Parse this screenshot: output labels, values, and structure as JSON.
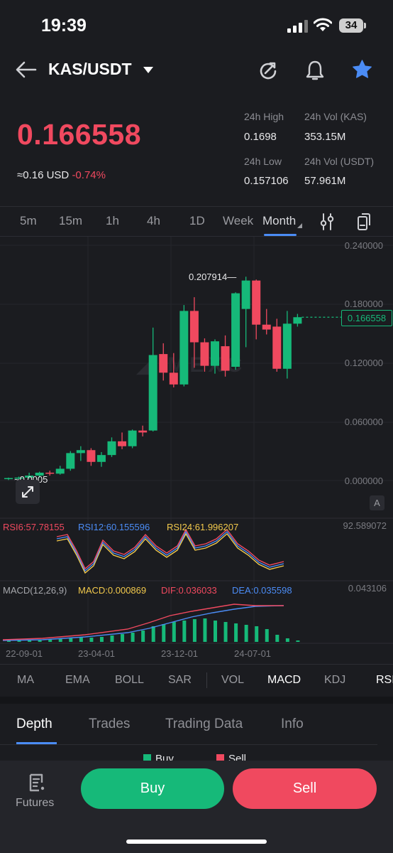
{
  "status_bar": {
    "time": "19:39",
    "battery": "34"
  },
  "header": {
    "pair": "KAS/USDT"
  },
  "ticker": {
    "last_price": "0.166558",
    "usd_approx": "≈0.16 USD",
    "change_pct": "-0.74%",
    "high_label": "24h High",
    "high_value": "0.1698",
    "vol_kas_label": "24h Vol (KAS)",
    "vol_kas_value": "353.15M",
    "low_label": "24h Low",
    "low_value": "0.157106",
    "vol_usdt_label": "24h Vol (USDT)",
    "vol_usdt_value": "57.961M"
  },
  "timeframes": [
    "5m",
    "15m",
    "1h",
    "4h",
    "1D",
    "Week",
    "Month"
  ],
  "active_timeframe": "Month",
  "price_axis": [
    "0.240000",
    "0.180000",
    "0.120000",
    "0.060000",
    "0.000000"
  ],
  "last_price_tag": "0.166558",
  "high_marker": "0.207914",
  "low_marker": "0.0005",
  "auto_button": "A",
  "rsi": {
    "rsi6": "RSI6:57.78155",
    "rsi12": "RSI12:60.155596",
    "rsi24": "RSI24:61.996207",
    "axis_max": "92.589072"
  },
  "macd": {
    "label": "MACD(12,26,9)",
    "macd": "MACD:0.000869",
    "dif": "DIF:0.036033",
    "dea": "DEA:0.035598",
    "axis_max": "0.043106"
  },
  "time_axis": [
    "22-09-01",
    "23-04-01",
    "23-12-01",
    "24-07-01"
  ],
  "indicator_tabs": [
    "MA",
    "EMA",
    "BOLL",
    "SAR",
    "VOL",
    "MACD",
    "KDJ",
    "RSI"
  ],
  "active_indicator": "MACD",
  "bottom_tabs": [
    "Depth",
    "Trades",
    "Trading Data",
    "Info"
  ],
  "active_bottom_tab": "Depth",
  "depth_legend": {
    "buy": "Buy",
    "sell": "Sell"
  },
  "footer": {
    "futures_label": "Futures",
    "buy_label": "Buy",
    "sell_label": "Sell"
  },
  "colors": {
    "up": "#16b979",
    "down": "#f0495f",
    "accent": "#4b8cf5",
    "background": "#1b1c20"
  },
  "chart_data": {
    "type": "candlestick",
    "interval": "Month",
    "candles": [
      {
        "t": "2022-09",
        "o": 0.002,
        "h": 0.003,
        "l": 0.0005,
        "c": 0.0025
      },
      {
        "t": "2022-10",
        "o": 0.0025,
        "h": 0.004,
        "l": 0.0015,
        "c": 0.003
      },
      {
        "t": "2022-11",
        "o": 0.003,
        "h": 0.008,
        "l": 0.002,
        "c": 0.005
      },
      {
        "t": "2022-12",
        "o": 0.005,
        "h": 0.009,
        "l": 0.003,
        "c": 0.008
      },
      {
        "t": "2023-01",
        "o": 0.008,
        "h": 0.01,
        "l": 0.005,
        "c": 0.007
      },
      {
        "t": "2023-02",
        "o": 0.007,
        "h": 0.015,
        "l": 0.006,
        "c": 0.012
      },
      {
        "t": "2023-03",
        "o": 0.012,
        "h": 0.03,
        "l": 0.01,
        "c": 0.028
      },
      {
        "t": "2023-04",
        "o": 0.028,
        "h": 0.035,
        "l": 0.02,
        "c": 0.031
      },
      {
        "t": "2023-05",
        "o": 0.031,
        "h": 0.033,
        "l": 0.015,
        "c": 0.019
      },
      {
        "t": "2023-06",
        "o": 0.019,
        "h": 0.029,
        "l": 0.014,
        "c": 0.026
      },
      {
        "t": "2023-07",
        "o": 0.026,
        "h": 0.044,
        "l": 0.024,
        "c": 0.04
      },
      {
        "t": "2023-08",
        "o": 0.04,
        "h": 0.049,
        "l": 0.032,
        "c": 0.035
      },
      {
        "t": "2023-09",
        "o": 0.035,
        "h": 0.052,
        "l": 0.033,
        "c": 0.051
      },
      {
        "t": "2023-10",
        "o": 0.051,
        "h": 0.056,
        "l": 0.045,
        "c": 0.049
      },
      {
        "t": "2023-11",
        "o": 0.051,
        "h": 0.156,
        "l": 0.05,
        "c": 0.128
      },
      {
        "t": "2023-12",
        "o": 0.129,
        "h": 0.14,
        "l": 0.102,
        "c": 0.11
      },
      {
        "t": "2024-01",
        "o": 0.11,
        "h": 0.13,
        "l": 0.095,
        "c": 0.098
      },
      {
        "t": "2024-02",
        "o": 0.098,
        "h": 0.179,
        "l": 0.096,
        "c": 0.173
      },
      {
        "t": "2024-03",
        "o": 0.173,
        "h": 0.187,
        "l": 0.115,
        "c": 0.141
      },
      {
        "t": "2024-04",
        "o": 0.141,
        "h": 0.145,
        "l": 0.111,
        "c": 0.117
      },
      {
        "t": "2024-05",
        "o": 0.117,
        "h": 0.144,
        "l": 0.109,
        "c": 0.142
      },
      {
        "t": "2024-06",
        "o": 0.137,
        "h": 0.148,
        "l": 0.106,
        "c": 0.112
      },
      {
        "t": "2024-07",
        "o": 0.116,
        "h": 0.192,
        "l": 0.113,
        "c": 0.191
      },
      {
        "t": "2024-08",
        "o": 0.175,
        "h": 0.2079,
        "l": 0.136,
        "c": 0.204
      },
      {
        "t": "2024-09",
        "o": 0.204,
        "h": 0.205,
        "l": 0.144,
        "c": 0.159
      },
      {
        "t": "2024-10",
        "o": 0.159,
        "h": 0.175,
        "l": 0.149,
        "c": 0.154
      },
      {
        "t": "2024-11",
        "o": 0.157,
        "h": 0.165,
        "l": 0.111,
        "c": 0.114
      },
      {
        "t": "2024-12",
        "o": 0.114,
        "h": 0.173,
        "l": 0.104,
        "c": 0.16
      },
      {
        "t": "2025-01",
        "o": 0.16,
        "h": 0.17,
        "l": 0.157,
        "c": 0.1666
      }
    ],
    "ylim": [
      0,
      0.24
    ]
  }
}
